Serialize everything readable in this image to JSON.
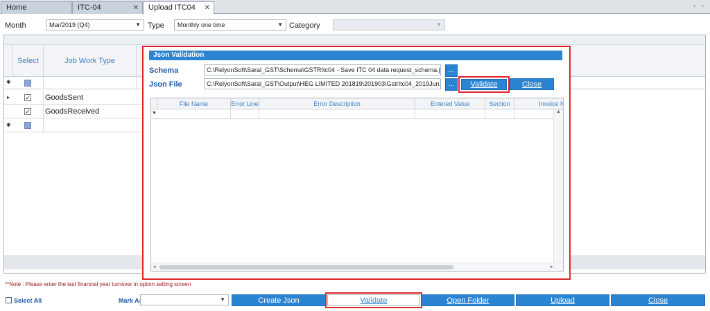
{
  "tabs": [
    {
      "label": "Home",
      "closable": false
    },
    {
      "label": "ITC-04",
      "closable": true
    },
    {
      "label": "Upload ITC04",
      "closable": true
    }
  ],
  "tab_nav": {
    "prev": "‹",
    "next": "›"
  },
  "filters": {
    "month_label": "Month",
    "month_value": "Mar/2019 (Q4)",
    "type_label": "Type",
    "type_value": "Monthly one time",
    "category_label": "Category",
    "category_value": ""
  },
  "main_grid": {
    "columns": [
      "Select",
      "Job Work Type"
    ],
    "rows": [
      {
        "indicator": "▸",
        "checked": true,
        "job_work_type": "GoodsSent"
      },
      {
        "indicator": "",
        "checked": true,
        "job_work_type": "GoodsReceived"
      }
    ],
    "new_row_indicator": "✱",
    "filter_indicator": "↕"
  },
  "dialog": {
    "title": "Json Validation",
    "schema_label": "Schema",
    "schema_path": "C:\\RelyonSoft\\Saral_GST\\Schema\\GSTRItc04 - Save ITC 04 data request_schema.js",
    "json_file_label": "Json File",
    "json_file_path": "C:\\RelyonSoft\\Saral_GST\\Output\\HEG LIMITED 201819\\201903\\GstrItc04_2019Jun1",
    "browse_label": "...",
    "validate_label": "Validate",
    "close_label": "Close",
    "grid_columns": [
      "File Name",
      "Error Line",
      "Error Description",
      "Entered Value",
      "Section",
      "Invoice No"
    ],
    "filter_icon": "▼"
  },
  "note": "**Note : Please enter the last financial year turnover in option setting screen",
  "bottom": {
    "select_all_label": "Select All",
    "mark_as_label": "Mark As",
    "mark_as_value": "",
    "buttons": [
      "Create Json",
      "Validate",
      "Open Folder",
      "Upload",
      "Close"
    ]
  },
  "colors": {
    "accent_blue": "#2b84d2",
    "highlight_red": "#e0252b",
    "header_text": "#3a7fc8",
    "note_text": "#9a1010"
  }
}
